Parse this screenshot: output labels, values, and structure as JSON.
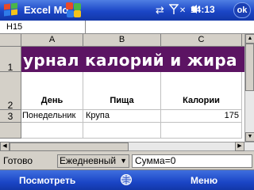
{
  "titlebar": {
    "app_title": "Excel Mo",
    "time": "14:13",
    "ok_label": "ok",
    "icons": [
      "windows-start-icon",
      "app-logo-icon",
      "sync-arrows-icon",
      "signal-icon",
      "close-x-icon",
      "volume-icon"
    ]
  },
  "formula_bar": {
    "cell_ref": "H15",
    "value": ""
  },
  "sheet": {
    "columns": [
      "A",
      "B",
      "C"
    ],
    "rows": [
      "1",
      "2",
      "3"
    ],
    "banner": "урнал калорий и жира",
    "headers": {
      "day": "День",
      "food": "Пища",
      "calories": "Калории"
    },
    "data": {
      "day": "Понедельник",
      "food": "Крупа",
      "calories": "175"
    }
  },
  "statusbar": {
    "status": "Готово",
    "view_dropdown": "Ежедневный",
    "sum": "Сумма=0"
  },
  "menubar": {
    "left_softkey": "Посмотреть",
    "right_softkey": "Меню"
  },
  "colors": {
    "banner_bg": "#5c1463",
    "title_bar": "#1b46c6",
    "chrome_gray": "#d4d0c8"
  }
}
